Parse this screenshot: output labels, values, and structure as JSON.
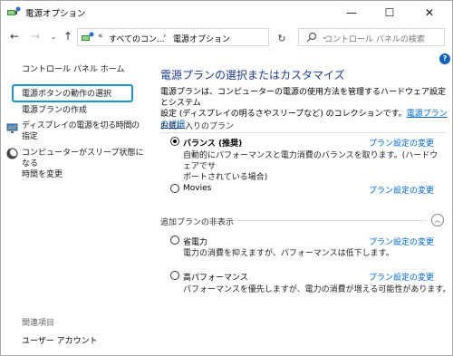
{
  "window": {
    "title": "電源オプション",
    "controls": {
      "minimize": "—",
      "maximize": "☐",
      "close": "✕"
    }
  },
  "nav": {
    "back": "←",
    "forward": "→",
    "dropdown": "⌄",
    "up": "↑",
    "address_chevron": "«",
    "address_part1": "すべてのコン...",
    "address_sep": "›",
    "address_part2": "電源オプション",
    "address_dropdown": "⌄",
    "refresh": "↻",
    "search_placeholder": "コントロール パネルの検索"
  },
  "sidebar": {
    "home": "コントロール パネル ホーム",
    "items": [
      {
        "label": "電源ボタンの動作の選択",
        "selected": true
      },
      {
        "label": "電源プランの作成"
      },
      {
        "label": "ディスプレイの電源を切る時間の指定",
        "line2": "定",
        "icon": "display-icon"
      },
      {
        "label": "コンピューターがスリープ状態になる",
        "line2": "時間を変更",
        "icon": "moon-icon"
      }
    ],
    "related_heading": "関連項目",
    "related_items": [
      "ユーザー アカウント"
    ]
  },
  "main": {
    "help": "?",
    "title": "電源プランの選択またはカスタマイズ",
    "description_line1": "電源プランは、コンピューターの電源の使用方法を管理するハードウェア設定とシステム",
    "description_line2": "設定 (ディスプレイの明るさやスリープなど) のコレクションです。",
    "description_link": "電源プランの詳細",
    "favorites_heading": "お気に入りのプラン",
    "hidden_heading": "追加プランの非表示",
    "change_label": "プラン設定の変更",
    "plans": [
      {
        "name": "バランス (推奨)",
        "checked": true,
        "desc_line1": "自動的にパフォーマンスと電力消費のバランスを取ります。(ハードウェアでサ",
        "desc_line2": "ポートされている場合)"
      },
      {
        "name": "Movies",
        "checked": false
      },
      {
        "name": "省電力",
        "checked": false,
        "desc_line1": "電力の消費を抑えますが、パフォーマンスは低下します。"
      },
      {
        "name": "高パフォーマンス",
        "checked": false,
        "desc_line1": "パフォーマンスを優先しますが、電力の消費が増える可能性があります。"
      }
    ],
    "collapse": "︿"
  }
}
